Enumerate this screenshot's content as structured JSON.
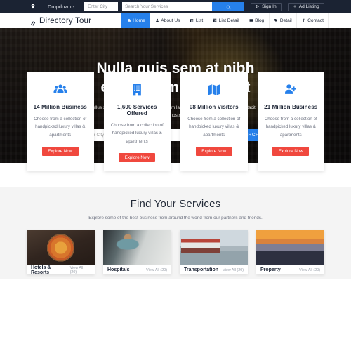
{
  "topbar": {
    "location_icon": "map-pin-icon",
    "dropdown_label": "Dropdown -",
    "city_placeholder": "Enter City",
    "services_placeholder": "Search Your Services",
    "search_icon": "search-icon",
    "signin_label": "Sign In",
    "signin_icon": "sign-in-icon",
    "adlisting_label": "Ad Listing",
    "adlisting_icon": "plus-icon",
    "bg_color": "#1b2333",
    "accent_color": "#2680eb"
  },
  "navbar": {
    "brand": "Directory Tour",
    "brand_icon": "diamond-logo-icon",
    "items": [
      {
        "label": "Home",
        "icon": "home-icon",
        "active": true
      },
      {
        "label": "About Us",
        "icon": "user-icon",
        "active": false
      },
      {
        "label": "List",
        "icon": "list-icon",
        "active": false
      },
      {
        "label": "List Detail",
        "icon": "grid-icon",
        "active": false
      },
      {
        "label": "Blog",
        "icon": "image-icon",
        "active": false
      },
      {
        "label": "Detail",
        "icon": "tag-icon",
        "active": false
      },
      {
        "label": "Contact",
        "icon": "book-icon",
        "active": false
      }
    ]
  },
  "hero": {
    "title_line1": "Nulla quis sem at nibh",
    "title_line2": "elementum imperdiet",
    "subtitle": "Fusce nec tellus sed augue semper porta. Vestibulum lacinia arcu eget nulla. Class aptent taciti sociosqu ad litora torquent per conubia nostra, per inceptos himenaeos.",
    "city_placeholder": "Enter City",
    "services_placeholder": "Search Your Services",
    "search_label": "SEARCH"
  },
  "features": [
    {
      "icon": "users-group-icon",
      "title": "14 Million Business",
      "desc": "Choose from a collection of handpicked luxury villas & apartments",
      "button": "Explore Now"
    },
    {
      "icon": "building-icon",
      "title": "1,600 Services Offered",
      "desc": "Choose from a collection of handpicked luxury villas & apartments",
      "button": "Explore Now"
    },
    {
      "icon": "map-icon",
      "title": "08 Million Visitors",
      "desc": "Choose from a collection of handpicked luxury villas & apartments",
      "button": "Explore Now"
    },
    {
      "icon": "user-add-icon",
      "title": "21 Million Business",
      "desc": "Choose from a collection of handpicked luxury villas & apartments",
      "button": "Explore Now"
    }
  ],
  "services": {
    "title": "Find Your Services",
    "subtitle": "Explore some of the best business from around the world from our partners and friends.",
    "cards": [
      {
        "image": "pizza-photo",
        "name": "Hotels & Resorts",
        "link": "View All (20)"
      },
      {
        "image": "dental-photo",
        "name": "Hospitals",
        "link": "View All (20)"
      },
      {
        "image": "ship-photo",
        "name": "Transportation",
        "link": "View All (20)"
      },
      {
        "image": "city-photo",
        "name": "Property",
        "link": "View All (20)"
      }
    ]
  }
}
